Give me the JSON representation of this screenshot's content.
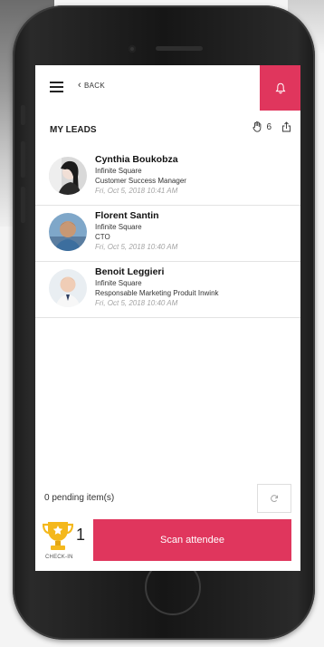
{
  "header": {
    "back_label": "BACK",
    "menu_icon": "hamburger-menu-icon",
    "bell_icon": "bell-icon",
    "accent": "#e0365d"
  },
  "leads_header": {
    "title": "MY LEADS",
    "hand_icon": "hand-icon",
    "count": "6",
    "share_icon": "share-icon"
  },
  "leads": [
    {
      "name": "Cynthia Boukobza",
      "company": "Infinite Square",
      "title": "Customer Success Manager",
      "date": "Fri, Oct 5, 2018 10:41 AM"
    },
    {
      "name": "Florent Santin",
      "company": "Infinite Square",
      "title": "CTO",
      "date": "Fri, Oct 5, 2018 10:40 AM"
    },
    {
      "name": "Benoit Leggieri",
      "company": "Infinite Square",
      "title": "Responsable Marketing Produit Inwink",
      "date": "Fri, Oct 5, 2018 10:40 AM"
    }
  ],
  "footer": {
    "pending": "0 pending item(s)",
    "sync_icon": "sync-icon",
    "trophy_icon": "trophy-icon",
    "trophy_count": "1",
    "trophy_label": "CHECK-IN",
    "scan_label": "Scan attendee"
  }
}
